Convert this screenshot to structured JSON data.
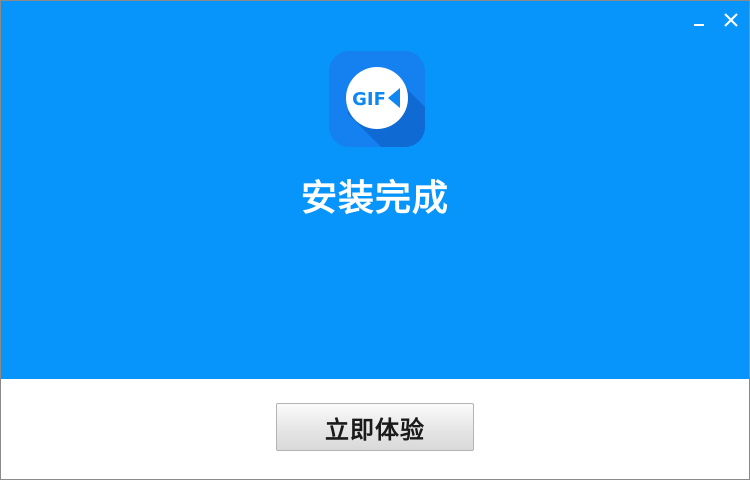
{
  "window": {
    "minimize_icon": "minimize-icon",
    "close_icon": "close-icon"
  },
  "header": {
    "logo_text": "GIF",
    "logo_icon": "video-camera-icon",
    "title": "安装完成"
  },
  "footer": {
    "primary_button_label": "立即体验"
  },
  "colors": {
    "header_background": "#0895fb",
    "logo_background": "#1581f0",
    "button_text": "#1a1a1a"
  }
}
